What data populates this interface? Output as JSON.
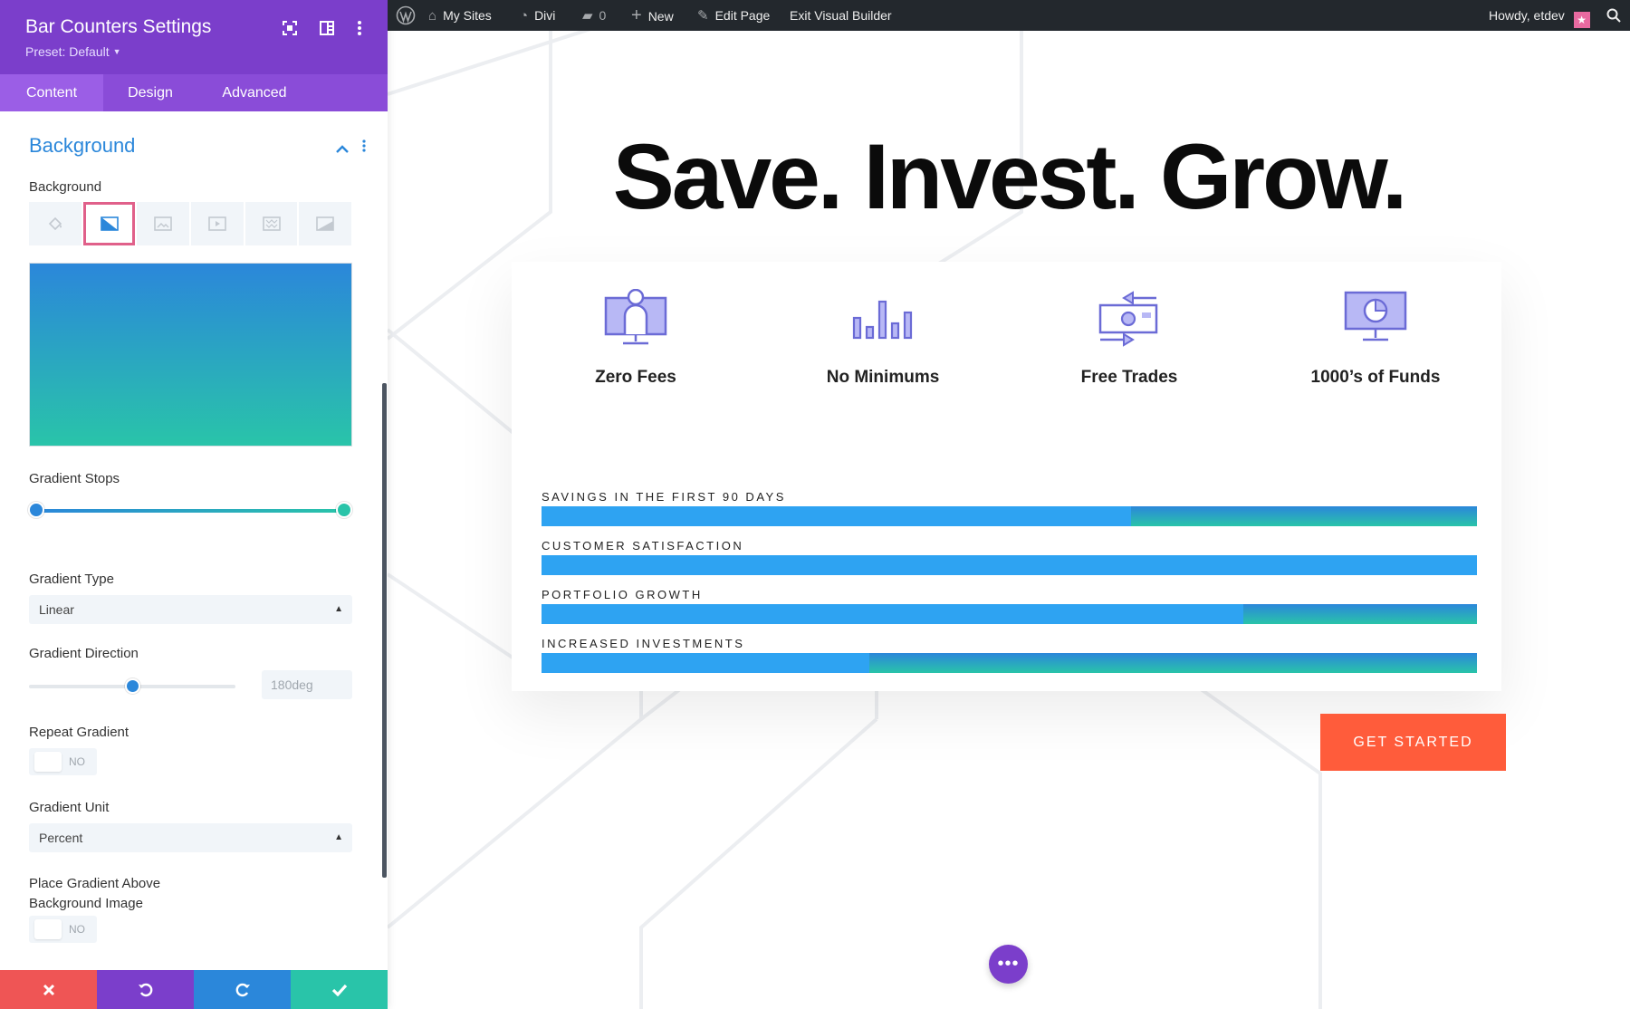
{
  "panel": {
    "title": "Bar Counters Settings",
    "preset": "Preset: Default",
    "tabs": [
      {
        "label": "Content",
        "active": true
      },
      {
        "label": "Design",
        "active": false
      },
      {
        "label": "Advanced",
        "active": false
      }
    ],
    "section_title": "Background",
    "background_label": "Background",
    "background_types": [
      "color",
      "gradient",
      "image",
      "video",
      "pattern",
      "mask"
    ],
    "active_background_type": "gradient",
    "gradient": {
      "start_color": "#2b87da",
      "end_color": "#29c4a9"
    },
    "gradient_stops_label": "Gradient Stops",
    "gradient_type_label": "Gradient Type",
    "gradient_type_value": "Linear",
    "gradient_direction_label": "Gradient Direction",
    "gradient_direction_value": "180deg",
    "repeat_gradient_label": "Repeat Gradient",
    "repeat_gradient_value": "NO",
    "gradient_unit_label": "Gradient Unit",
    "gradient_unit_value": "Percent",
    "place_above_label_line1": "Place Gradient Above",
    "place_above_label_line2": "Background Image",
    "place_above_value": "NO",
    "actions": [
      "cancel",
      "undo",
      "redo",
      "save"
    ],
    "action_colors": [
      "#ef5555",
      "#7b3ecb",
      "#2b87da",
      "#29c4a9"
    ]
  },
  "adminbar": {
    "my_sites": "My Sites",
    "divi": "Divi",
    "comments": "0",
    "new": "New",
    "edit_page": "Edit Page",
    "exit_builder": "Exit Visual Builder",
    "howdy": "Howdy, etdev"
  },
  "page": {
    "headline": "Save. Invest. Grow.",
    "features": [
      {
        "label": "Zero Fees",
        "icon": "person-monitor-icon"
      },
      {
        "label": "No Minimums",
        "icon": "bar-chart-icon"
      },
      {
        "label": "Free Trades",
        "icon": "money-transfer-icon"
      },
      {
        "label": "1000’s of Funds",
        "icon": "pie-monitor-icon"
      }
    ],
    "bars": [
      {
        "title": "SAVINGS IN THE FIRST 90 DAYS",
        "percent": 63
      },
      {
        "title": "CUSTOMER SATISFACTION",
        "percent": 100
      },
      {
        "title": "PORTFOLIO GROWTH",
        "percent": 75
      },
      {
        "title": "INCREASED INVESTMENTS",
        "percent": 35
      }
    ],
    "cta": "GET STARTED",
    "fab": "•••",
    "accent": "#2ea3f2",
    "cta_color": "#ff5c3b"
  }
}
